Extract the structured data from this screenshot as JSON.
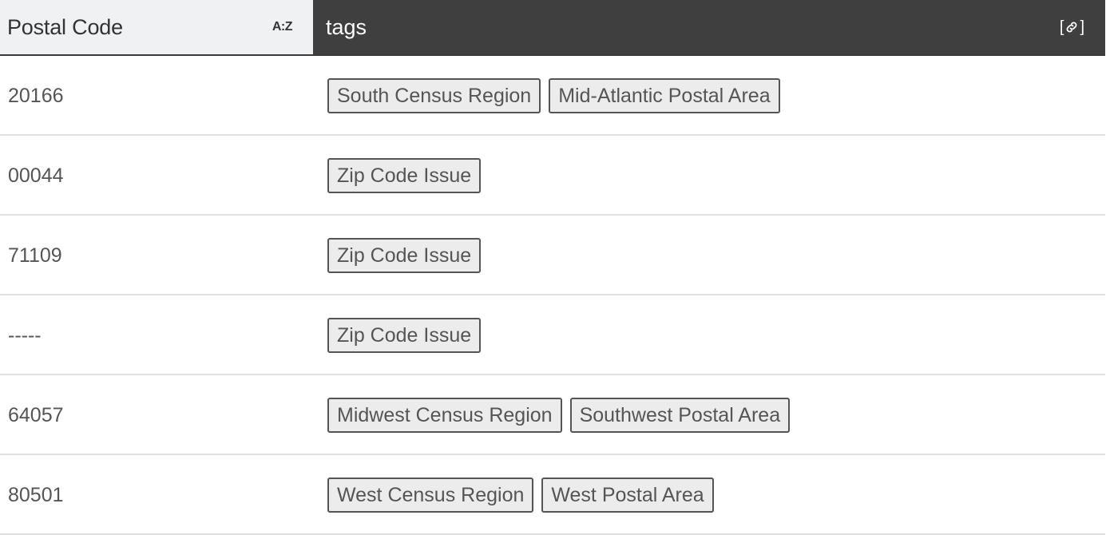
{
  "header": {
    "postal_code_label": "Postal Code",
    "sort_label": "A:Z",
    "tags_label": "tags",
    "link_icon": "link-icon"
  },
  "rows": [
    {
      "postal_code": "20166",
      "tags": [
        "South Census Region",
        "Mid-Atlantic Postal Area"
      ]
    },
    {
      "postal_code": "00044",
      "tags": [
        "Zip Code Issue"
      ]
    },
    {
      "postal_code": "71109",
      "tags": [
        "Zip Code Issue"
      ]
    },
    {
      "postal_code": "-----",
      "tags": [
        "Zip Code Issue"
      ]
    },
    {
      "postal_code": "64057",
      "tags": [
        "Midwest Census Region",
        "Southwest Postal Area"
      ]
    },
    {
      "postal_code": "80501",
      "tags": [
        "West Census Region",
        "West Postal Area"
      ]
    }
  ],
  "colors": {
    "header_left_bg": "#f0f1f3",
    "header_right_bg": "#3f3f3f",
    "tag_bg": "#ececec",
    "tag_border": "#555555",
    "row_divider": "#e0e0e0"
  }
}
